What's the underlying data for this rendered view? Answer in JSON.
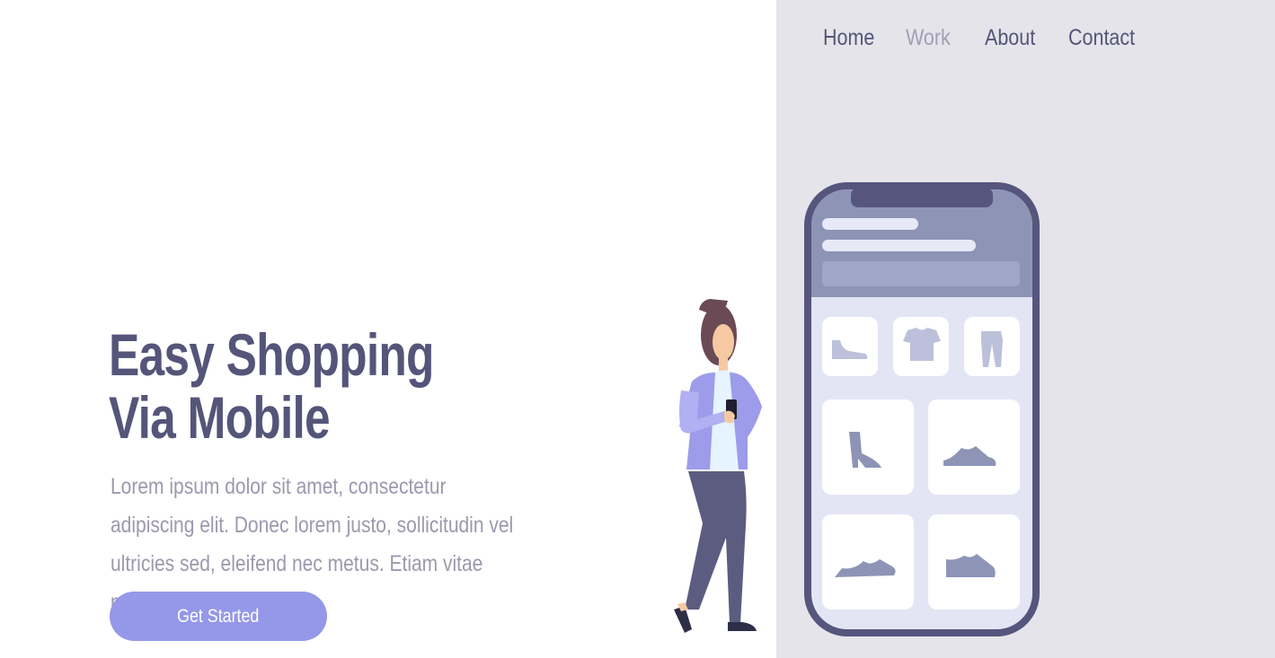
{
  "nav": {
    "items": [
      {
        "label": "Home"
      },
      {
        "label": "Work"
      },
      {
        "label": "About"
      },
      {
        "label": "Contact"
      }
    ]
  },
  "hero": {
    "title_line1": "Easy Shopping",
    "title_line2": "Via Mobile",
    "description": "Lorem ipsum dolor sit amet, consectetur adipiscing elit. Donec lorem justo, sollicitudin vel ultricies sed, eleifend nec metus. Etiam vitae pellentesque dolor.",
    "cta_label": "Get Started"
  },
  "colors": {
    "primary_text": "#55557a",
    "muted_text": "#9a99ae",
    "button": "#9597e8",
    "panel_bg": "#e5e4ea"
  }
}
